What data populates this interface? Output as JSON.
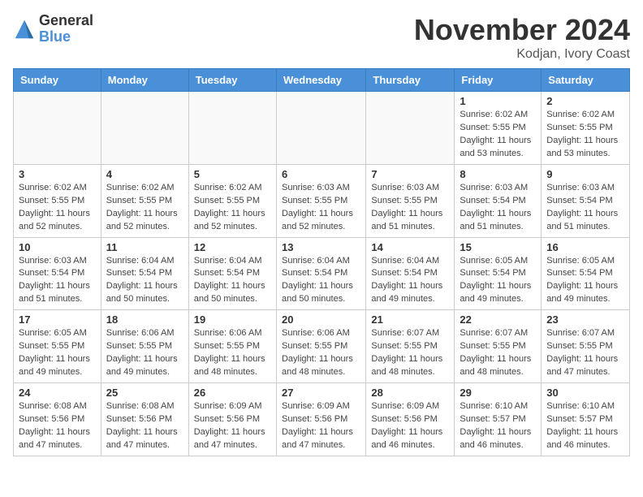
{
  "logo": {
    "general": "General",
    "blue": "Blue"
  },
  "title": "November 2024",
  "location": "Kodjan, Ivory Coast",
  "weekdays": [
    "Sunday",
    "Monday",
    "Tuesday",
    "Wednesday",
    "Thursday",
    "Friday",
    "Saturday"
  ],
  "weeks": [
    [
      {
        "day": "",
        "info": ""
      },
      {
        "day": "",
        "info": ""
      },
      {
        "day": "",
        "info": ""
      },
      {
        "day": "",
        "info": ""
      },
      {
        "day": "",
        "info": ""
      },
      {
        "day": "1",
        "info": "Sunrise: 6:02 AM\nSunset: 5:55 PM\nDaylight: 11 hours\nand 53 minutes."
      },
      {
        "day": "2",
        "info": "Sunrise: 6:02 AM\nSunset: 5:55 PM\nDaylight: 11 hours\nand 53 minutes."
      }
    ],
    [
      {
        "day": "3",
        "info": "Sunrise: 6:02 AM\nSunset: 5:55 PM\nDaylight: 11 hours\nand 52 minutes."
      },
      {
        "day": "4",
        "info": "Sunrise: 6:02 AM\nSunset: 5:55 PM\nDaylight: 11 hours\nand 52 minutes."
      },
      {
        "day": "5",
        "info": "Sunrise: 6:02 AM\nSunset: 5:55 PM\nDaylight: 11 hours\nand 52 minutes."
      },
      {
        "day": "6",
        "info": "Sunrise: 6:03 AM\nSunset: 5:55 PM\nDaylight: 11 hours\nand 52 minutes."
      },
      {
        "day": "7",
        "info": "Sunrise: 6:03 AM\nSunset: 5:55 PM\nDaylight: 11 hours\nand 51 minutes."
      },
      {
        "day": "8",
        "info": "Sunrise: 6:03 AM\nSunset: 5:54 PM\nDaylight: 11 hours\nand 51 minutes."
      },
      {
        "day": "9",
        "info": "Sunrise: 6:03 AM\nSunset: 5:54 PM\nDaylight: 11 hours\nand 51 minutes."
      }
    ],
    [
      {
        "day": "10",
        "info": "Sunrise: 6:03 AM\nSunset: 5:54 PM\nDaylight: 11 hours\nand 51 minutes."
      },
      {
        "day": "11",
        "info": "Sunrise: 6:04 AM\nSunset: 5:54 PM\nDaylight: 11 hours\nand 50 minutes."
      },
      {
        "day": "12",
        "info": "Sunrise: 6:04 AM\nSunset: 5:54 PM\nDaylight: 11 hours\nand 50 minutes."
      },
      {
        "day": "13",
        "info": "Sunrise: 6:04 AM\nSunset: 5:54 PM\nDaylight: 11 hours\nand 50 minutes."
      },
      {
        "day": "14",
        "info": "Sunrise: 6:04 AM\nSunset: 5:54 PM\nDaylight: 11 hours\nand 49 minutes."
      },
      {
        "day": "15",
        "info": "Sunrise: 6:05 AM\nSunset: 5:54 PM\nDaylight: 11 hours\nand 49 minutes."
      },
      {
        "day": "16",
        "info": "Sunrise: 6:05 AM\nSunset: 5:54 PM\nDaylight: 11 hours\nand 49 minutes."
      }
    ],
    [
      {
        "day": "17",
        "info": "Sunrise: 6:05 AM\nSunset: 5:55 PM\nDaylight: 11 hours\nand 49 minutes."
      },
      {
        "day": "18",
        "info": "Sunrise: 6:06 AM\nSunset: 5:55 PM\nDaylight: 11 hours\nand 49 minutes."
      },
      {
        "day": "19",
        "info": "Sunrise: 6:06 AM\nSunset: 5:55 PM\nDaylight: 11 hours\nand 48 minutes."
      },
      {
        "day": "20",
        "info": "Sunrise: 6:06 AM\nSunset: 5:55 PM\nDaylight: 11 hours\nand 48 minutes."
      },
      {
        "day": "21",
        "info": "Sunrise: 6:07 AM\nSunset: 5:55 PM\nDaylight: 11 hours\nand 48 minutes."
      },
      {
        "day": "22",
        "info": "Sunrise: 6:07 AM\nSunset: 5:55 PM\nDaylight: 11 hours\nand 48 minutes."
      },
      {
        "day": "23",
        "info": "Sunrise: 6:07 AM\nSunset: 5:55 PM\nDaylight: 11 hours\nand 47 minutes."
      }
    ],
    [
      {
        "day": "24",
        "info": "Sunrise: 6:08 AM\nSunset: 5:56 PM\nDaylight: 11 hours\nand 47 minutes."
      },
      {
        "day": "25",
        "info": "Sunrise: 6:08 AM\nSunset: 5:56 PM\nDaylight: 11 hours\nand 47 minutes."
      },
      {
        "day": "26",
        "info": "Sunrise: 6:09 AM\nSunset: 5:56 PM\nDaylight: 11 hours\nand 47 minutes."
      },
      {
        "day": "27",
        "info": "Sunrise: 6:09 AM\nSunset: 5:56 PM\nDaylight: 11 hours\nand 47 minutes."
      },
      {
        "day": "28",
        "info": "Sunrise: 6:09 AM\nSunset: 5:56 PM\nDaylight: 11 hours\nand 46 minutes."
      },
      {
        "day": "29",
        "info": "Sunrise: 6:10 AM\nSunset: 5:57 PM\nDaylight: 11 hours\nand 46 minutes."
      },
      {
        "day": "30",
        "info": "Sunrise: 6:10 AM\nSunset: 5:57 PM\nDaylight: 11 hours\nand 46 minutes."
      }
    ]
  ]
}
